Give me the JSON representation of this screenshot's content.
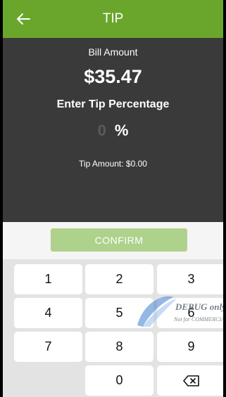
{
  "appbar": {
    "title": "TIP"
  },
  "bill": {
    "label": "Bill Amount",
    "value": "$35.47"
  },
  "tip": {
    "heading": "Enter Tip Percentage",
    "input_value": "0",
    "percent_symbol": "%",
    "amount_text": "Tip Amount: $0.00"
  },
  "confirm": {
    "label": "CONFIRM"
  },
  "keypad": {
    "k1": "1",
    "k2": "2",
    "k3": "3",
    "k4": "4",
    "k5": "5",
    "k6": "6",
    "k7": "7",
    "k8": "8",
    "k9": "9",
    "k0": "0",
    "backspace_icon": "backspace-icon"
  },
  "watermark": {
    "line1": "DEBUG only",
    "line2": "Not for COMMERCIAL"
  },
  "colors": {
    "accent": "#6aa62c",
    "panel": "#3a3a3a",
    "confirm_disabled": "#aed28c"
  }
}
